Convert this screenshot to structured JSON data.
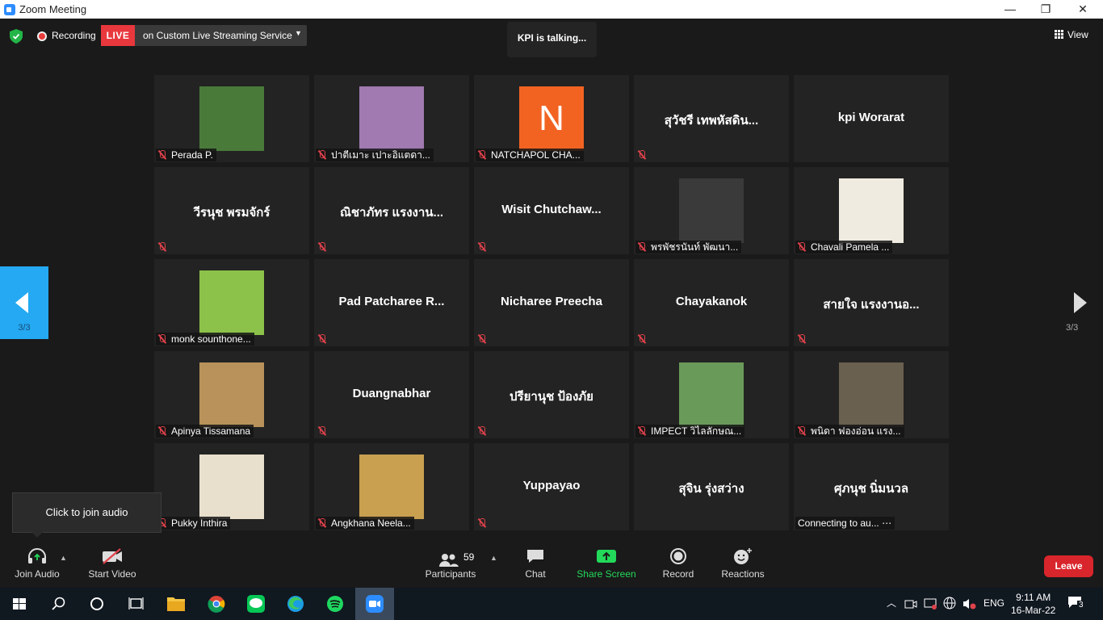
{
  "window": {
    "title": "Zoom Meeting",
    "minimize": "—",
    "restore": "❐",
    "close": "✕"
  },
  "topbar": {
    "recording": "Recording",
    "live_badge": "LIVE",
    "live_text": "on Custom Live Streaming Service",
    "live_caret": "▼",
    "talking": "KPI is talking...",
    "view": "View"
  },
  "tiles": [
    {
      "label": "Perada P.",
      "mode": "photo",
      "photo_color": "#4a7a3a"
    },
    {
      "label": "ปาตีเมาะ เปาะอิแตดา...",
      "mode": "photo",
      "photo_color": "#a07ab0"
    },
    {
      "label": "NATCHAPOL CHA...",
      "mode": "avatar",
      "avatar_letter": "N"
    },
    {
      "center_name": "สุวัชรี เทพหัสดิน...",
      "mode": "name"
    },
    {
      "center_name": "kpi Worarat",
      "mode": "name",
      "no_mic": true
    },
    {
      "center_name": "วีรนุช พรมจักร์",
      "mode": "name"
    },
    {
      "center_name": "ณิชาภัทร แรงงาน...",
      "mode": "name"
    },
    {
      "center_name": "Wisit  Chutchaw...",
      "mode": "name"
    },
    {
      "label": "พรพัชรนันท์ พัฒนา...",
      "mode": "photo",
      "photo_color": "#3a3a3a"
    },
    {
      "label": "Chavali Pamela ...",
      "mode": "photo",
      "photo_color": "#f0ebe0"
    },
    {
      "label": "monk sounthone...",
      "mode": "photo",
      "photo_color": "#8cc24a"
    },
    {
      "center_name": "Pad Patcharee R...",
      "mode": "name"
    },
    {
      "center_name": "Nicharee Preecha",
      "mode": "name"
    },
    {
      "center_name": "Chayakanok",
      "mode": "name"
    },
    {
      "center_name": "สายใจ แรงงานอ...",
      "mode": "name"
    },
    {
      "label": "Apinya Tissamana",
      "mode": "photo",
      "photo_color": "#b8925a"
    },
    {
      "center_name": "Duangnabhar",
      "mode": "name"
    },
    {
      "center_name": "ปรียานุช ป้องภัย",
      "mode": "name"
    },
    {
      "label": "IMPECT วิไลลักษณ...",
      "mode": "photo",
      "photo_color": "#6a9a5a"
    },
    {
      "label": "พนิดา ฟองอ่อน แรง...",
      "mode": "photo",
      "photo_color": "#6a6050"
    },
    {
      "label": "Pukky Inthira",
      "mode": "photo",
      "photo_color": "#e8e0cc"
    },
    {
      "label": "Angkhana Neela...",
      "mode": "photo",
      "photo_color": "#c8a050"
    },
    {
      "center_name": "Yuppayao",
      "mode": "name"
    },
    {
      "center_name": "สุจิน รุ่งสว่าง",
      "mode": "name",
      "no_mic": true
    },
    {
      "center_name": "ศุภนุช นิ่มนวล",
      "mode": "name",
      "status": "Connecting to au... ⋯"
    }
  ],
  "pager": {
    "left_count": "3/3",
    "right_count": "3/3"
  },
  "tooltip": "Click to join audio",
  "toolbar": {
    "join_audio": "Join Audio",
    "start_video": "Start Video",
    "participants": "Participants",
    "participants_count": "59",
    "chat": "Chat",
    "share_screen": "Share Screen",
    "record": "Record",
    "reactions": "Reactions",
    "leave": "Leave"
  },
  "taskbar": {
    "lang": "ENG",
    "time": "9:11 AM",
    "date": "16-Mar-22",
    "notifications": "3"
  },
  "colors": {
    "live_red": "#e8383d",
    "share_green": "#23d959",
    "leave_red": "#d9252c",
    "pager_blue": "#24a9f2",
    "mic_off_red": "#e0424b"
  }
}
